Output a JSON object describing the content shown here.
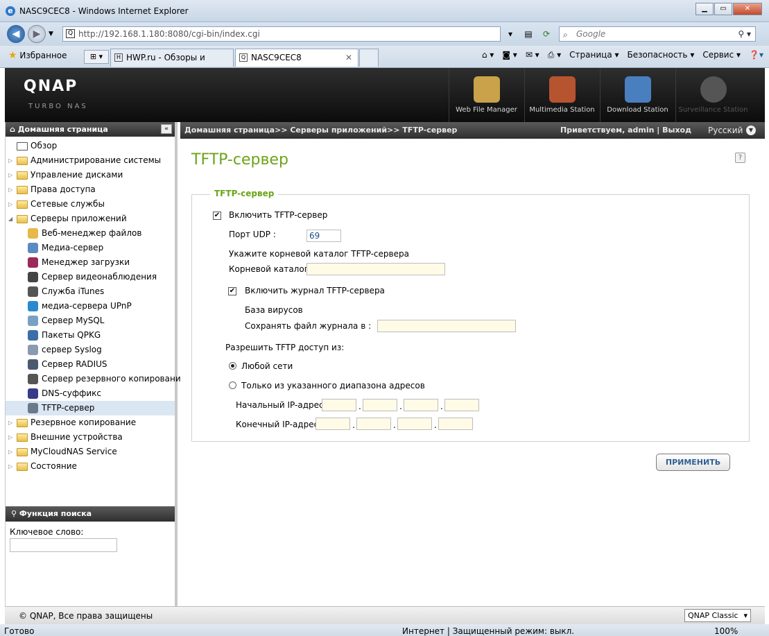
{
  "browser": {
    "title": "NASC9CEC8 - Windows Internet Explorer",
    "url": "http://192.168.1.180:8080/cgi-bin/index.cgi",
    "search_placeholder": "Google",
    "favorites_label": "Избранное",
    "tabs": [
      {
        "label": "HWP.ru - Обзоры и тесты...",
        "active": false
      },
      {
        "label": "NASC9CEC8",
        "active": true
      }
    ],
    "command_bar": [
      "Страница ▾",
      "Безопасность ▾",
      "Сервис ▾"
    ],
    "status_left": "Готово",
    "status_zone": "Интернет | Защищенный режим: выкл.",
    "status_zoom": "100%"
  },
  "qnap": {
    "logo": "QNAP",
    "subtitle": "Turbo NAS",
    "stations": [
      {
        "label": "Web File Manager",
        "icon": "file-manager-icon",
        "color": "#c9a24a",
        "enabled": true
      },
      {
        "label": "Multimedia Station",
        "icon": "multimedia-icon",
        "color": "#b6542f",
        "enabled": true
      },
      {
        "label": "Download Station",
        "icon": "download-icon",
        "color": "#4a7fbf",
        "enabled": true
      },
      {
        "label": "Surveillance Station",
        "icon": "camera-icon",
        "color": "#6c6c6c",
        "enabled": false
      }
    ]
  },
  "sidebar": {
    "header": "Домашняя страница",
    "items": [
      {
        "label": "Обзор",
        "level": 0,
        "type": "page"
      },
      {
        "label": "Администрирование системы",
        "level": 0,
        "type": "folder"
      },
      {
        "label": "Управление дисками",
        "level": 0,
        "type": "folder"
      },
      {
        "label": "Права доступа",
        "level": 0,
        "type": "folder"
      },
      {
        "label": "Сетевые службы",
        "level": 0,
        "type": "folder"
      },
      {
        "label": "Серверы приложений",
        "level": 0,
        "type": "folder-open"
      },
      {
        "label": "Веб-менеджер файлов",
        "level": 1,
        "icon": "folder-icon",
        "color": "#e8b84a"
      },
      {
        "label": "Медиа-сервер",
        "level": 1,
        "icon": "media-icon",
        "color": "#5a8ac4"
      },
      {
        "label": "Менеджер загрузки",
        "level": 1,
        "icon": "download-manager-icon",
        "color": "#9a2a5a"
      },
      {
        "label": "Сервер видеонаблюдения",
        "level": 1,
        "icon": "camera-icon",
        "color": "#444444"
      },
      {
        "label": "Служба iTunes",
        "level": 1,
        "icon": "apple-icon",
        "color": "#555555"
      },
      {
        "label": "медиа-сервера UPnP",
        "level": 1,
        "icon": "upnp-icon",
        "color": "#2a8ad0"
      },
      {
        "label": "Сервер MySQL",
        "level": 1,
        "icon": "mysql-icon",
        "color": "#7aa0c4"
      },
      {
        "label": "Пакеты QPKG",
        "level": 1,
        "icon": "qpkg-icon",
        "color": "#3c6ea8"
      },
      {
        "label": "сервер Syslog",
        "level": 1,
        "icon": "syslog-icon",
        "color": "#8a9ab0"
      },
      {
        "label": "Сервер RADIUS",
        "level": 1,
        "icon": "radius-icon",
        "color": "#4a5a70"
      },
      {
        "label": "Сервер резервного копирования",
        "level": 1,
        "icon": "backup-server-icon",
        "color": "#555555"
      },
      {
        "label": "DNS-суффикс",
        "level": 1,
        "icon": "dns-icon",
        "color": "#3a3a8a"
      },
      {
        "label": "TFTP-сервер",
        "level": 1,
        "icon": "tftp-icon",
        "color": "#6a7a8a",
        "selected": true
      },
      {
        "label": "Резервное копирование",
        "level": 0,
        "type": "folder"
      },
      {
        "label": "Внешние устройства",
        "level": 0,
        "type": "folder"
      },
      {
        "label": "MyCloudNAS Service",
        "level": 0,
        "type": "folder"
      },
      {
        "label": "Состояние",
        "level": 0,
        "type": "folder"
      }
    ],
    "search": {
      "header": "Функция поиска",
      "keyword_label": "Ключевое слово:",
      "keyword_value": ""
    }
  },
  "header": {
    "breadcrumb": "Домашняя страница>> Серверы приложений>> TFTP-сервер",
    "welcome": "Приветствуем, admin | Выход",
    "language": "Русский"
  },
  "page": {
    "title": "TFTP-сервер",
    "help": "?",
    "fieldset_legend": "TFTP-сервер",
    "enable_label": "Включить TFTP-сервер",
    "enable_checked": true,
    "udp_port_label": "Порт UDP :",
    "udp_port_value": "69",
    "root_hint": "Укажите корневой каталог TFTP-сервера",
    "root_label": "Корневой каталог:",
    "root_value": "",
    "log_label": "Включить журнал TFTP-сервера",
    "log_checked": true,
    "virus_base_label": "База вирусов",
    "log_save_label": "Сохранять файл журнала в :",
    "log_save_value": "",
    "access_label": "Разрешить TFTP доступ из:",
    "any_network_label": "Любой сети",
    "range_label": "Только из указанного диапазона адресов",
    "selected_access": "any",
    "start_ip_label": "Начальный IP-адрес:",
    "end_ip_label": "Конечный IP-адрес:",
    "start_ip": [
      "",
      "",
      "",
      ""
    ],
    "end_ip": [
      "",
      "",
      "",
      ""
    ],
    "apply_label": "ПРИМЕНИТЬ"
  },
  "footer": {
    "copyright": "© QNAP, Все права защищены",
    "theme": "QNAP Classic"
  }
}
